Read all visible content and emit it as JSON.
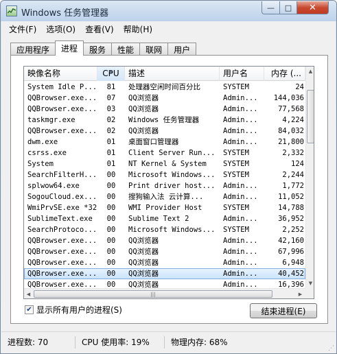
{
  "window": {
    "title": "Windows 任务管理器",
    "controls": {
      "minimize": "—",
      "maximize": "□",
      "close": "✕"
    }
  },
  "menu": [
    "文件(F)",
    "选项(O)",
    "查看(V)",
    "帮助(H)"
  ],
  "tabs": [
    {
      "label": "应用程序",
      "active": false
    },
    {
      "label": "进程",
      "active": true
    },
    {
      "label": "服务",
      "active": false
    },
    {
      "label": "性能",
      "active": false
    },
    {
      "label": "联网",
      "active": false
    },
    {
      "label": "用户",
      "active": false
    }
  ],
  "table": {
    "columns": [
      "映像名称",
      "CPU",
      "描述",
      "用户名",
      "内存 (..."
    ],
    "sorted_column": "CPU",
    "rows": [
      [
        "System Idle P...",
        "81",
        "处理器空闲时间百分比",
        "SYSTEM",
        "24"
      ],
      [
        "QQBrowser.exe...",
        "07",
        "QQ浏览器",
        "Admin...",
        "144,036"
      ],
      [
        "QQBrowser.exe...",
        "03",
        "QQ浏览器",
        "Admin...",
        "77,568"
      ],
      [
        "taskmgr.exe",
        "02",
        "Windows 任务管理器",
        "Admin...",
        "4,224"
      ],
      [
        "QQBrowser.exe...",
        "02",
        "QQ浏览器",
        "Admin...",
        "84,032"
      ],
      [
        "dwm.exe",
        "01",
        "桌面窗口管理器",
        "Admin...",
        "21,800"
      ],
      [
        "csrss.exe",
        "01",
        "Client Server Run...",
        "SYSTEM",
        "2,332"
      ],
      [
        "System",
        "01",
        "NT Kernel & System",
        "SYSTEM",
        "124"
      ],
      [
        "SearchFilterH...",
        "00",
        "Microsoft Windows...",
        "SYSTEM",
        "2,244"
      ],
      [
        "splwow64.exe",
        "00",
        "Print driver host...",
        "Admin...",
        "1,772"
      ],
      [
        "SogouCloud.ex...",
        "00",
        "搜狗输入法 云计算...",
        "Admin...",
        "11,052"
      ],
      [
        "WmiPrvSE.exe *32",
        "00",
        "WMI Provider Host",
        "SYSTEM",
        "14,788"
      ],
      [
        "SublimeText.exe",
        "00",
        "Sublime Text 2",
        "Admin...",
        "36,952"
      ],
      [
        "SearchProtoco...",
        "00",
        "Microsoft Windows...",
        "SYSTEM",
        "2,252"
      ],
      [
        "QQBrowser.exe...",
        "00",
        "QQ浏览器",
        "Admin...",
        "42,160"
      ],
      [
        "QQBrowser.exe...",
        "00",
        "QQ浏览器",
        "Admin...",
        "67,996"
      ],
      [
        "QQBrowser.exe...",
        "00",
        "QQ浏览器",
        "Admin...",
        "6,948"
      ],
      [
        "QQBrowser.exe...",
        "00",
        "QQ浏览器",
        "Admin...",
        "40,452"
      ],
      [
        "QQBrowser.exe...",
        "00",
        "QQ浏览器",
        "Admin...",
        "16,396"
      ]
    ],
    "selected_row": 17
  },
  "show_all_users": {
    "label": "显示所有用户的进程(S)",
    "checked": true
  },
  "end_process_label": "结束进程(E)",
  "status": {
    "processes": "进程数: 70",
    "cpu": "CPU 使用率: 19%",
    "memory": "物理内存: 68%"
  }
}
